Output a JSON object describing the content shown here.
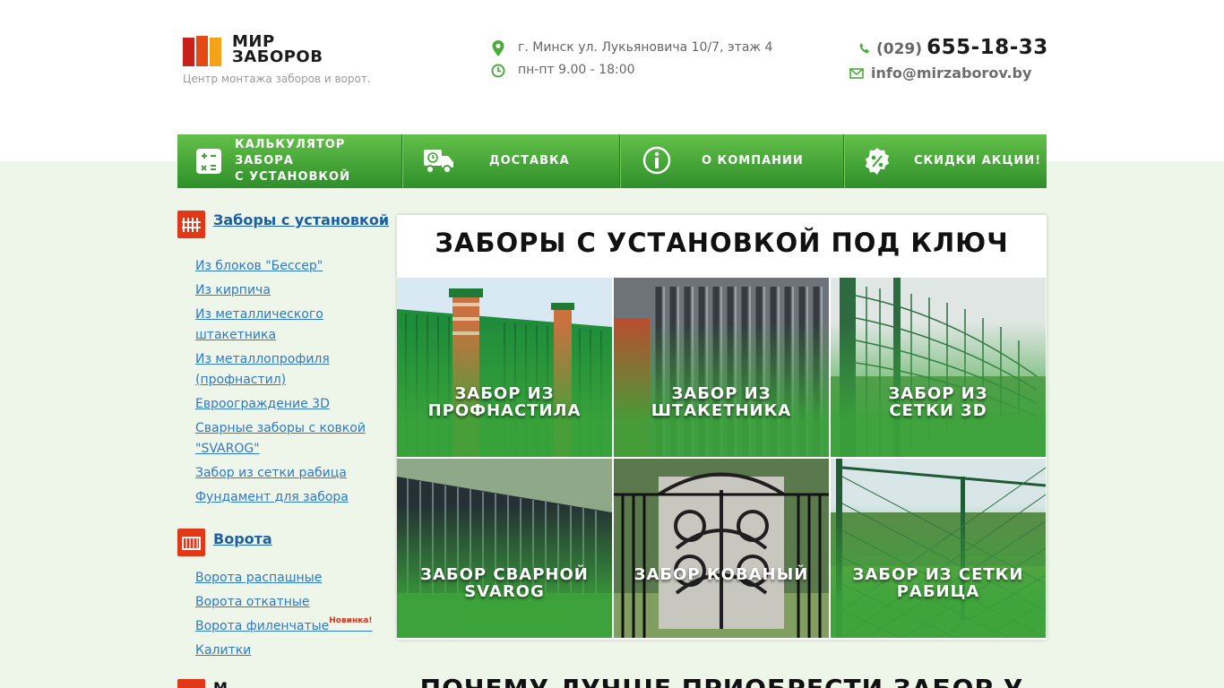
{
  "header": {
    "logo_line1": "МИР",
    "logo_line2": "ЗАБОРОВ",
    "tagline": "Центр монтажа заборов и ворот.",
    "address": "г. Минск ул. Лукьяновича 10/7, этаж 4",
    "hours": "пн-пт 9.00 - 18:00",
    "phone_code": "(029)",
    "phone_number": "655-18-33",
    "email": "info@mirzaborov.by"
  },
  "nav": {
    "calc_line1": "КАЛЬКУЛЯТОР ЗАБОРА",
    "calc_line2": "С УСТАНОВКОЙ",
    "delivery": "ДОСТАВКА",
    "about": "О КОМПАНИИ",
    "discounts": "СКИДКИ АКЦИИ!"
  },
  "sidebar": {
    "fences_title": "Заборы с установкой",
    "fences": [
      "Из блоков \"Бессер\"",
      "Из кирпича",
      "Из металлического штакетника",
      "Из металлопрофиля (профнастил)",
      "Евроограждение 3D",
      "Сварные заборы с ковкой \"SVAROG\"",
      "Забор из сетки рабица",
      "Фундамент для забора"
    ],
    "gates_title": "Ворота",
    "gates": [
      "Ворота распашные",
      "Ворота откатные",
      "Ворота филенчатые",
      "Калитки"
    ],
    "new_badge": "Новинка!",
    "third_title_partial": "М"
  },
  "main": {
    "title": "ЗАБОРЫ С УСТАНОВКОЙ ПОД КЛЮЧ",
    "tiles": [
      {
        "line1": "ЗАБОР ИЗ",
        "line2": "ПРОФНАСТИЛА"
      },
      {
        "line1": "ЗАБОР ИЗ",
        "line2": "ШТАКЕТНИКА"
      },
      {
        "line1": "ЗАБОР ИЗ",
        "line2": "СЕТКИ 3D"
      },
      {
        "line1": "ЗАБОР СВАРНОЙ",
        "line2": "SVAROG"
      },
      {
        "line1": "ЗАБОР КОВАНЫЙ",
        "line2": ""
      },
      {
        "line1": "ЗАБОР ИЗ СЕТКИ",
        "line2": "РАБИЦА"
      }
    ],
    "section2_title": "ПОЧЕМУ ЛУЧШЕ ПРИОБРЕСТИ ЗАБОР У"
  },
  "colors": {
    "nav_green": "#3fa535",
    "accent_red": "#e2381a",
    "link_blue": "#2f79c6"
  },
  "icons": {
    "address": "map-pin-icon",
    "hours": "clock-icon",
    "phone": "phone-icon",
    "email": "envelope-icon",
    "calc": "calculator-icon",
    "delivery": "truck-icon",
    "about": "info-icon",
    "discounts": "percent-icon"
  }
}
